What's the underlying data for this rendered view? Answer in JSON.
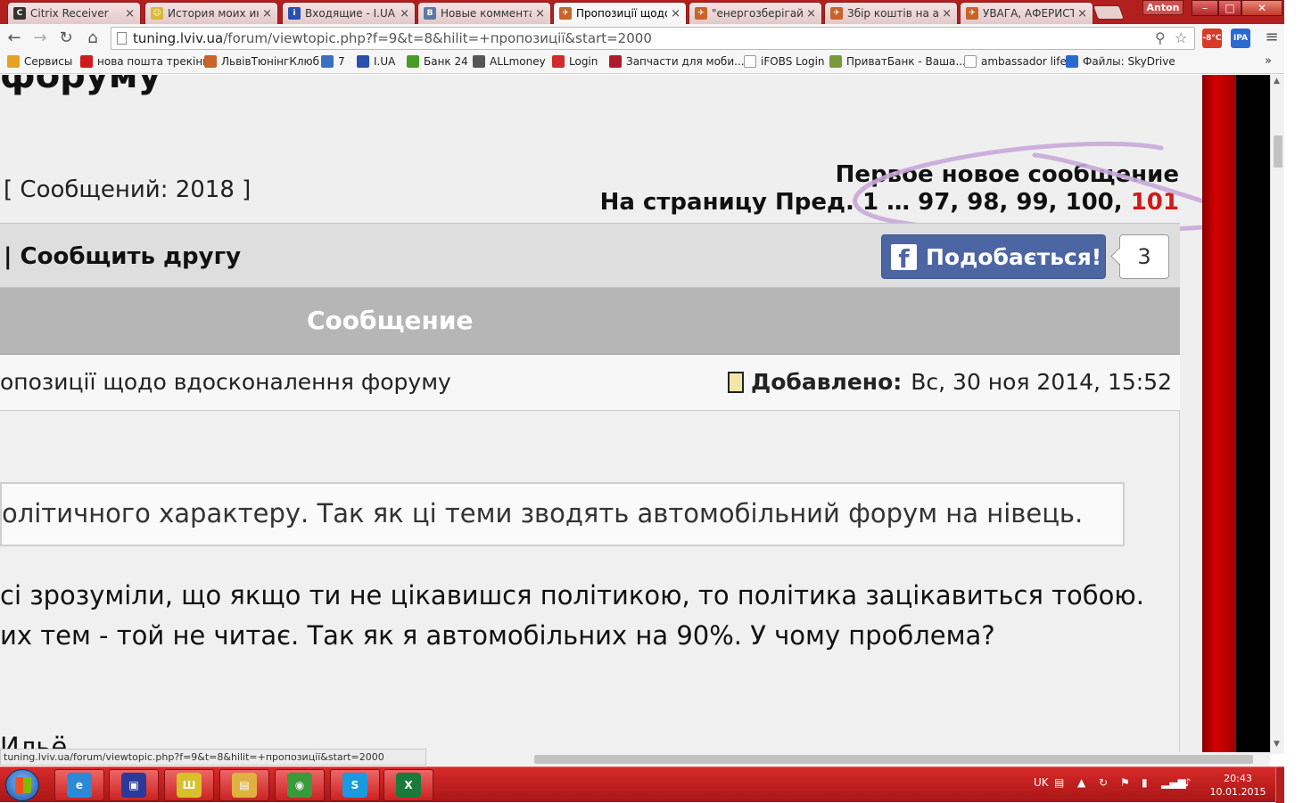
{
  "browser": {
    "tabs": [
      {
        "title": "Citrix Receiver",
        "color": "#333333",
        "glyph": "C"
      },
      {
        "title": "История моих ин",
        "color": "#d9b83a",
        "glyph": "☺"
      },
      {
        "title": "Входящие - I.UA",
        "color": "#2a4fb0",
        "glyph": "i"
      },
      {
        "title": "Новые коммента",
        "color": "#5a7aa8",
        "glyph": "B"
      },
      {
        "title": "Пропозиції щодо",
        "color": "#c8642a",
        "glyph": "✈",
        "active": true
      },
      {
        "title": "\"енергозберігайк",
        "color": "#c8642a",
        "glyph": "✈"
      },
      {
        "title": "Збір коштів на ав",
        "color": "#c8642a",
        "glyph": "✈"
      },
      {
        "title": "УВАГА, АФЕРИСТ",
        "color": "#c8642a",
        "glyph": "✈"
      }
    ],
    "tab_close": "×",
    "profile_name": "Anton",
    "window_controls": {
      "minimize": "–",
      "maximize": "□",
      "close": "✕"
    },
    "nav": {
      "back": "←",
      "forward": "→",
      "reload": "↻",
      "home": "⌂"
    },
    "address": {
      "host": "tuning.lviv.ua",
      "path": "/forum/viewtopic.php?f=9&t=8&hilit=+пропозиції&start=2000"
    },
    "omnibox_icons": {
      "zoom": "⚲",
      "star": "☆"
    },
    "extensions": [
      {
        "label": "-8°C",
        "color": "#d83a2a"
      },
      {
        "label": "IPA",
        "color": "#2a6ad0"
      }
    ],
    "menu_glyph": "≡",
    "bookmarks": [
      {
        "label": "Сервисы",
        "color": "#e8a020"
      },
      {
        "label": "нова пошта трекінг",
        "color": "#d01a1a"
      },
      {
        "label": "ЛьвівТюнінгКлюб",
        "color": "#c8642a"
      },
      {
        "label": "7",
        "color": "#3a70c0"
      },
      {
        "label": "I.UA",
        "color": "#2a4fb0"
      },
      {
        "label": "Банк 24",
        "color": "#4a9a2a"
      },
      {
        "label": "ALLmoney",
        "color": "#555555"
      },
      {
        "label": "Login",
        "color": "#d02a2a"
      },
      {
        "label": "Запчасти для моби...",
        "color": "#b01a2a"
      },
      {
        "label": "iFOBS Login",
        "color": "#ffffff"
      },
      {
        "label": "ПриватБанк - Ваша...",
        "color": "#7a9a3a"
      },
      {
        "label": "ambassador life",
        "color": "#ffffff"
      },
      {
        "label": "Файлы: SkyDrive",
        "color": "#2a6ad0"
      }
    ],
    "bookmarks_more": "»"
  },
  "page": {
    "forum_title_fragment": "форуму",
    "post_count": "[ Сообщений: 2018 ]",
    "first_new": "Первое новое сообщение",
    "pagination": {
      "prefix": "На страницу Пред.",
      "pages": "1 … 97, 98, 99, 100,",
      "current": "101"
    },
    "tell_friend": "| Сообщить другу",
    "fb_like_label": "Подобається!",
    "fb_like_count": "3",
    "message_header": "Сообщение",
    "post_subject": "опозиції щодо вдосконалення форуму",
    "added_label": "Добавлено:",
    "added_date": "Вс, 30 ноя 2014, 15:52",
    "quote_text": "олітичного характеру. Так як ці теми зводять автомобільний форум на нівець.",
    "body_line1": "сі зрозуміли, що якщо ти не цікавишся політикою, то політика зацікавиться тобою.",
    "body_line2": "их тем - той не читає. Так як я автомобільних на 90%. У чому проблема?",
    "body_line3": "  Ильё",
    "status_url": "tuning.lviv.ua/forum/viewtopic.php?f=9&t=8&hilit=+пропозиції&start=2000"
  },
  "taskbar": {
    "apps": [
      {
        "name": "internet-explorer",
        "glyph": "e",
        "color": "#2a8ad8"
      },
      {
        "name": "save-disk",
        "glyph": "▣",
        "color": "#2a3a9a"
      },
      {
        "name": "trident-app",
        "glyph": "Ш",
        "color": "#d8c02a"
      },
      {
        "name": "file-explorer",
        "glyph": "▤",
        "color": "#e0b040"
      },
      {
        "name": "chrome",
        "glyph": "◉",
        "color": "#3a9a3a"
      },
      {
        "name": "skype",
        "glyph": "S",
        "color": "#1a9ae0"
      },
      {
        "name": "excel",
        "glyph": "X",
        "color": "#1a7a3a"
      }
    ],
    "language": "UK",
    "clock_time": "20:43",
    "clock_date": "10.01.2015"
  }
}
